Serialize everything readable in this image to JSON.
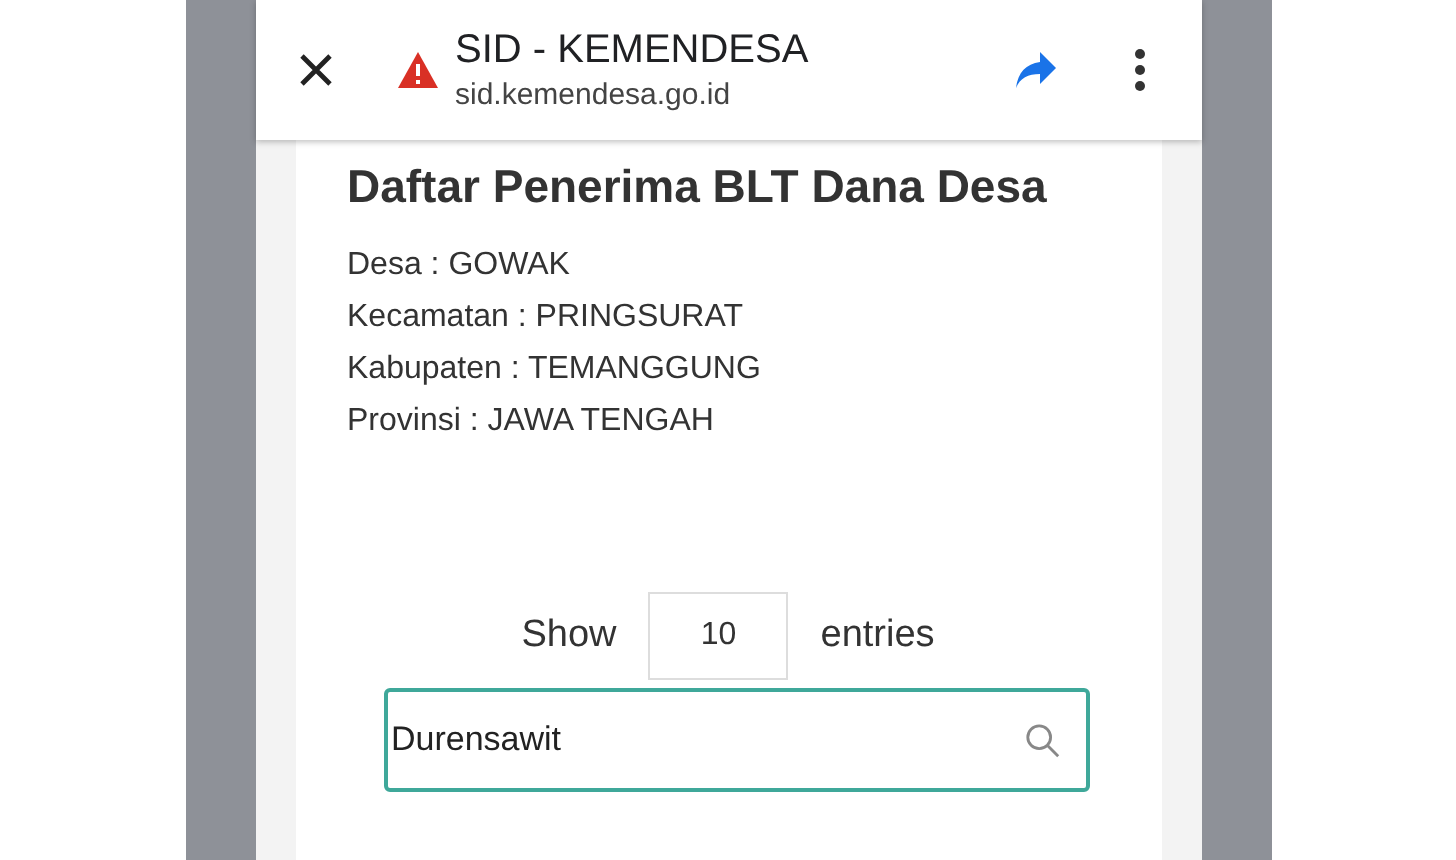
{
  "browser": {
    "title": "SID - KEMENDESA",
    "url": "sid.kemendesa.go.id"
  },
  "page": {
    "heading": "Daftar Penerima BLT Dana Desa",
    "details": [
      "Desa : GOWAK",
      "Kecamatan : PRINGSURAT",
      "Kabupaten : TEMANGGUNG",
      "Provinsi : JAWA TENGAH"
    ],
    "show_label": "Show",
    "entries_value": "10",
    "entries_label": "entries",
    "search_value": "Durensawit"
  }
}
